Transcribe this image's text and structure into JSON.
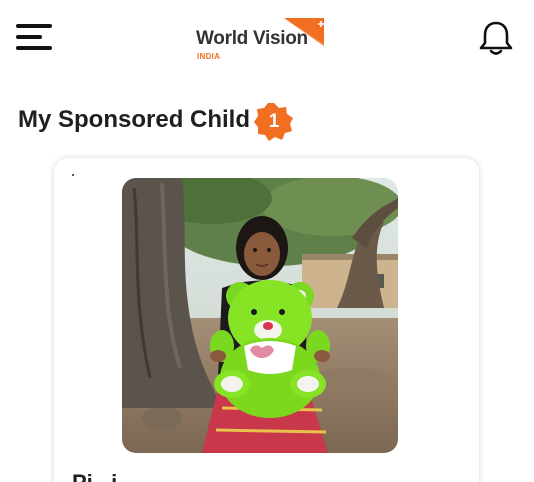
{
  "header": {
    "logo_text": "World Vision",
    "logo_sub": "INDIA",
    "brand_color": "#f26f21",
    "menu_icon": "hamburger-menu-icon",
    "notification_icon": "bell-icon"
  },
  "section": {
    "title": "My Sponsored Child",
    "count": "1",
    "badge_color": "#f26f21"
  },
  "child_card": {
    "name": "Pi...i...",
    "photo_alt": "sponsored child holding a green teddy bear"
  }
}
